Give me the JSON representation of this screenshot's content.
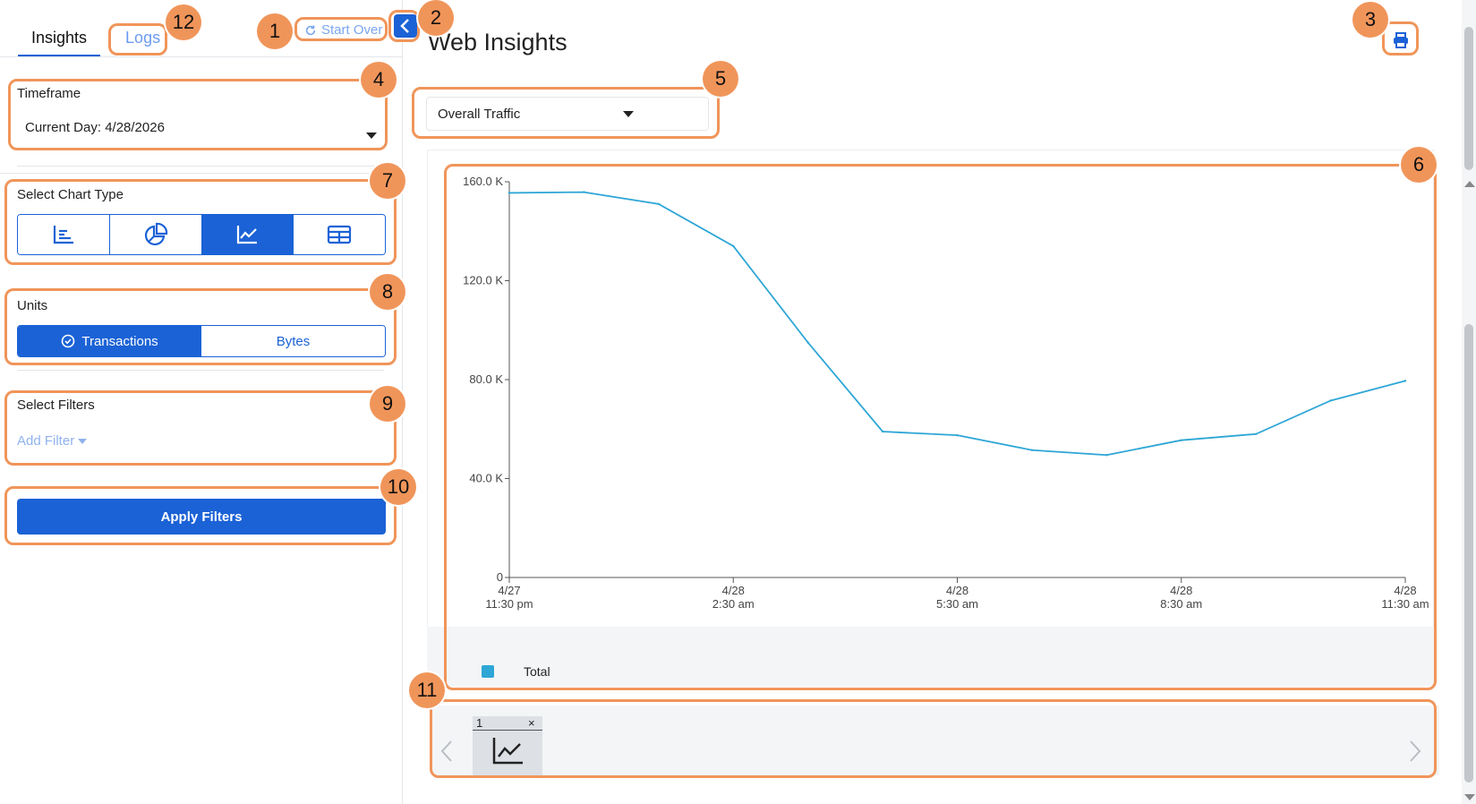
{
  "sidebar": {
    "tabs": [
      {
        "label": "Insights",
        "active": true
      },
      {
        "label": "Logs",
        "active": false
      }
    ],
    "start_over_label": "Start Over",
    "timeframe": {
      "label": "Timeframe",
      "value": "Current Day: 4/28/2026"
    },
    "chart_type": {
      "label": "Select Chart Type",
      "options": [
        {
          "icon": "bar-chart-icon",
          "active": false
        },
        {
          "icon": "pie-chart-icon",
          "active": false
        },
        {
          "icon": "line-chart-icon",
          "active": true
        },
        {
          "icon": "table-icon",
          "active": false
        }
      ]
    },
    "units": {
      "label": "Units",
      "options": [
        {
          "label": "Transactions",
          "active": true,
          "icon": "check-circle-icon"
        },
        {
          "label": "Bytes",
          "active": false
        }
      ]
    },
    "filters": {
      "label": "Select Filters",
      "add_label": "Add Filter"
    },
    "apply_label": "Apply Filters"
  },
  "main": {
    "title": "Web Insights",
    "metric_select": "Overall Traffic",
    "legend_label": "Total",
    "thumbnail": {
      "number": "1",
      "close": "×"
    }
  },
  "colors": {
    "accent": "#1b62d6",
    "series": "#2ea6d6",
    "annotation": "#f0955a"
  },
  "chart_data": {
    "type": "line",
    "x_labels": [
      [
        "4/27",
        "11:30 pm"
      ],
      [
        "4/28",
        "2:30 am"
      ],
      [
        "4/28",
        "5:30 am"
      ],
      [
        "4/28",
        "8:30 am"
      ],
      [
        "4/28",
        "11:30 am"
      ]
    ],
    "y_ticks": [
      "0",
      "40.0 K",
      "80.0 K",
      "120.0 K",
      "160.0 K"
    ],
    "ylim": [
      0,
      160000
    ],
    "series": [
      {
        "name": "Total",
        "x_hours": [
          0,
          1,
          2,
          3,
          4,
          5,
          6,
          7,
          8,
          9,
          10,
          11,
          12
        ],
        "values": [
          155500,
          155800,
          151000,
          134000,
          95000,
          59000,
          57500,
          51500,
          49500,
          55500,
          58000,
          71500,
          79500
        ]
      }
    ]
  },
  "annotations": [
    {
      "n": "1"
    },
    {
      "n": "2"
    },
    {
      "n": "3"
    },
    {
      "n": "4"
    },
    {
      "n": "5"
    },
    {
      "n": "6"
    },
    {
      "n": "7"
    },
    {
      "n": "8"
    },
    {
      "n": "9"
    },
    {
      "n": "10"
    },
    {
      "n": "11"
    },
    {
      "n": "12"
    }
  ]
}
